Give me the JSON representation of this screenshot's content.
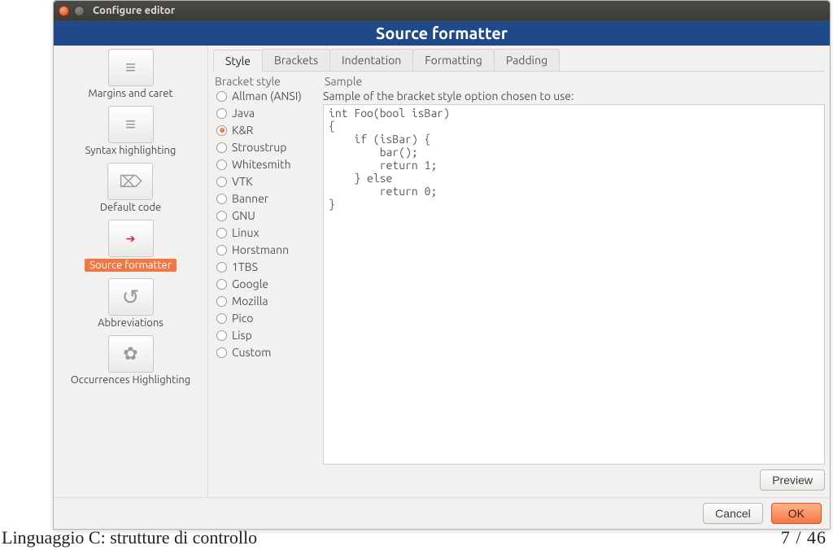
{
  "window": {
    "title": "Configure editor"
  },
  "banner": "Source formatter",
  "sidebar": {
    "items": [
      {
        "label": "Margins and caret",
        "icon": "ic-text"
      },
      {
        "label": "Syntax highlighting",
        "icon": "ic-text"
      },
      {
        "label": "Default code",
        "icon": "ic-stamp"
      },
      {
        "label": "Source formatter",
        "icon": "ic-red",
        "selected": true
      },
      {
        "label": "Abbreviations",
        "icon": "ic-arrow"
      },
      {
        "label": "Occurrences Highlighting",
        "icon": "ic-puzzle"
      }
    ]
  },
  "tabs": [
    {
      "label": "Style",
      "active": true
    },
    {
      "label": "Brackets"
    },
    {
      "label": "Indentation"
    },
    {
      "label": "Formatting"
    },
    {
      "label": "Padding"
    }
  ],
  "bracket": {
    "header": "Bracket style",
    "options": [
      "Allman (ANSI)",
      "Java",
      "K&R",
      "Stroustrup",
      "Whitesmith",
      "VTK",
      "Banner",
      "GNU",
      "Linux",
      "Horstmann",
      "1TBS",
      "Google",
      "Mozilla",
      "Pico",
      "Lisp",
      "Custom"
    ],
    "selected": "K&R"
  },
  "sample": {
    "header": "Sample",
    "desc": "Sample of the bracket style option chosen to use:",
    "code": "int Foo(bool isBar)\n{\n    if (isBar) {\n        bar();\n        return 1;\n    } else\n        return 0;\n}"
  },
  "buttons": {
    "preview": "Preview",
    "cancel": "Cancel",
    "ok": "OK"
  },
  "slide": {
    "title": "Linguaggio C: strutture di controllo",
    "page": "7 / 46"
  }
}
